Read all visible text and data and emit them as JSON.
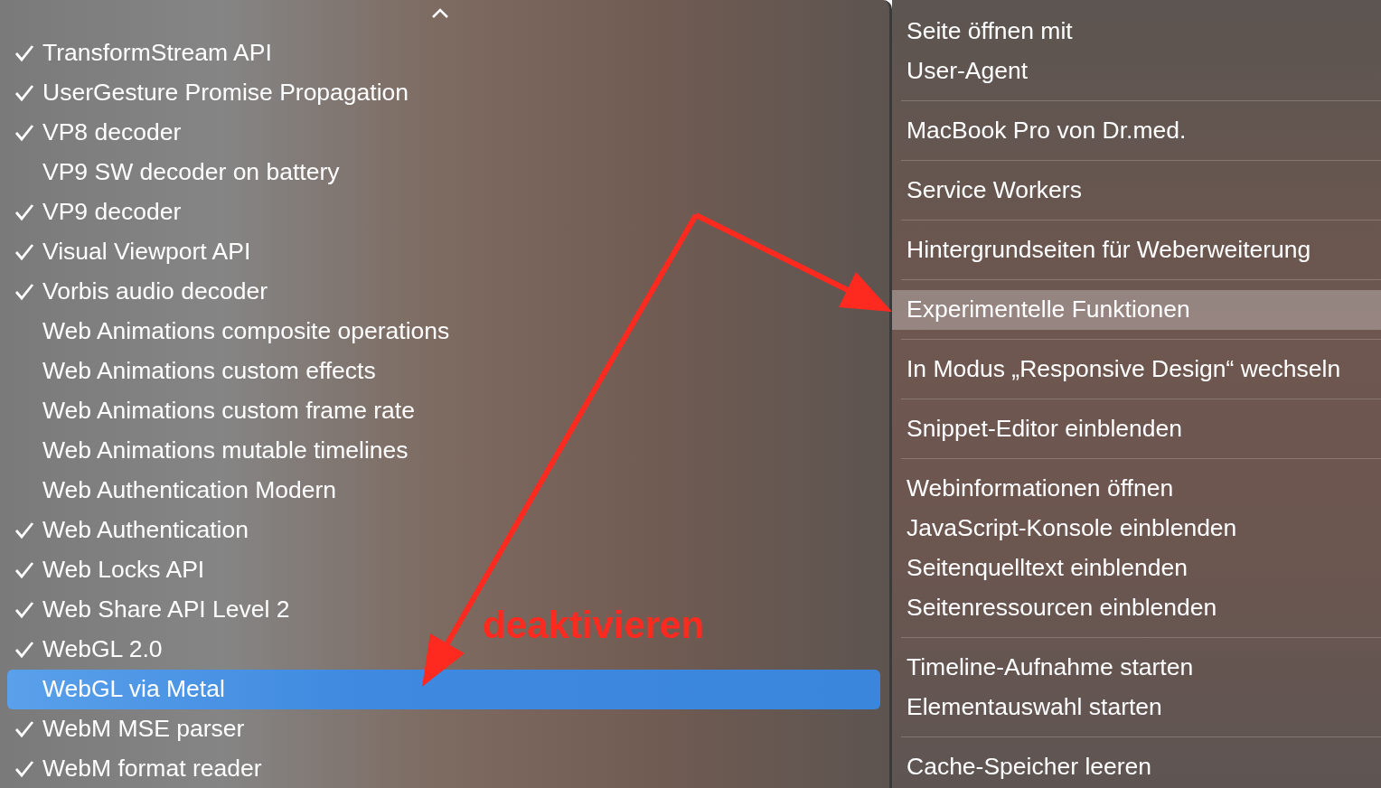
{
  "left_menu": {
    "items": [
      {
        "label": "TransformStream API",
        "checked": true,
        "selected": false
      },
      {
        "label": "UserGesture Promise Propagation",
        "checked": true,
        "selected": false
      },
      {
        "label": "VP8 decoder",
        "checked": true,
        "selected": false
      },
      {
        "label": "VP9 SW decoder on battery",
        "checked": false,
        "selected": false
      },
      {
        "label": "VP9 decoder",
        "checked": true,
        "selected": false
      },
      {
        "label": "Visual Viewport API",
        "checked": true,
        "selected": false
      },
      {
        "label": "Vorbis audio decoder",
        "checked": true,
        "selected": false
      },
      {
        "label": "Web Animations composite operations",
        "checked": false,
        "selected": false
      },
      {
        "label": "Web Animations custom effects",
        "checked": false,
        "selected": false
      },
      {
        "label": "Web Animations custom frame rate",
        "checked": false,
        "selected": false
      },
      {
        "label": "Web Animations mutable timelines",
        "checked": false,
        "selected": false
      },
      {
        "label": "Web Authentication Modern",
        "checked": false,
        "selected": false
      },
      {
        "label": "Web Authentication",
        "checked": true,
        "selected": false
      },
      {
        "label": "Web Locks API",
        "checked": true,
        "selected": false
      },
      {
        "label": "Web Share API Level 2",
        "checked": true,
        "selected": false
      },
      {
        "label": "WebGL 2.0",
        "checked": true,
        "selected": false
      },
      {
        "label": "WebGL via Metal",
        "checked": false,
        "selected": true
      },
      {
        "label": "WebM MSE parser",
        "checked": true,
        "selected": false
      },
      {
        "label": "WebM format reader",
        "checked": true,
        "selected": false
      }
    ]
  },
  "right_menu": {
    "groups": [
      {
        "items": [
          {
            "label": "Seite öffnen mit",
            "selected": false
          },
          {
            "label": "User-Agent",
            "selected": false
          }
        ]
      },
      {
        "items": [
          {
            "label": "MacBook Pro von Dr.med.",
            "selected": false
          }
        ]
      },
      {
        "items": [
          {
            "label": "Service Workers",
            "selected": false
          }
        ]
      },
      {
        "items": [
          {
            "label": "Hintergrundseiten für Weberweiterung",
            "selected": false
          }
        ]
      },
      {
        "items": [
          {
            "label": "Experimentelle Funktionen",
            "selected": true
          }
        ]
      },
      {
        "items": [
          {
            "label": "In Modus „Responsive Design“ wechseln",
            "selected": false
          }
        ]
      },
      {
        "items": [
          {
            "label": "Snippet-Editor einblenden",
            "selected": false
          }
        ]
      },
      {
        "items": [
          {
            "label": "Webinformationen öffnen",
            "selected": false
          },
          {
            "label": "JavaScript-Konsole einblenden",
            "selected": false
          },
          {
            "label": "Seitenquelltext einblenden",
            "selected": false
          },
          {
            "label": "Seitenressourcen einblenden",
            "selected": false
          }
        ]
      },
      {
        "items": [
          {
            "label": "Timeline-Aufnahme starten",
            "selected": false
          },
          {
            "label": "Elementauswahl starten",
            "selected": false
          }
        ]
      },
      {
        "items": [
          {
            "label": "Cache-Speicher leeren",
            "selected": false
          }
        ]
      }
    ]
  },
  "annotation": {
    "text": "deaktivieren"
  }
}
